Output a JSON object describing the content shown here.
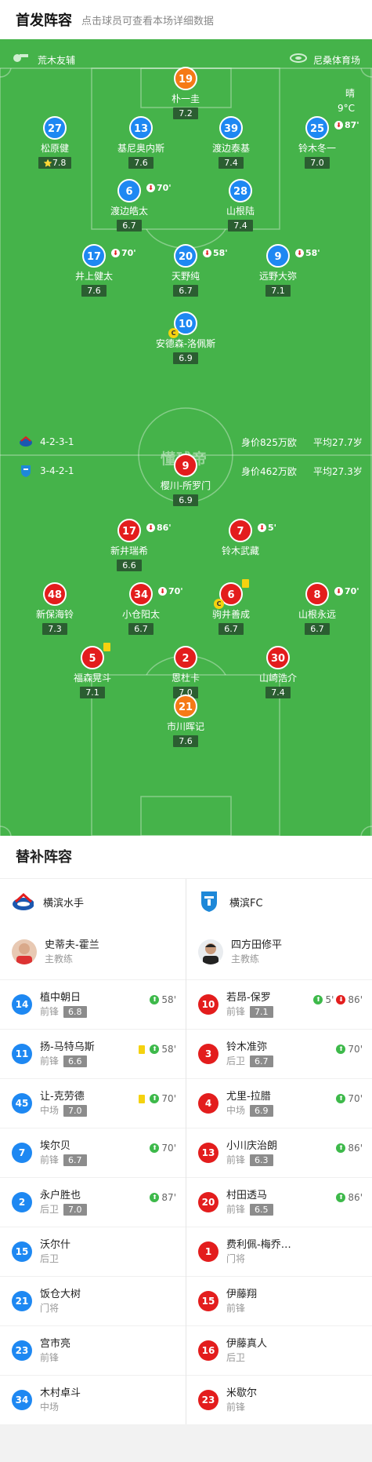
{
  "header": {
    "title": "首发阵容",
    "subtitle": "点击球员可查看本场详细数据"
  },
  "pitch": {
    "referee": "荒木友辅",
    "stadium": "尼桑体育场",
    "weather": "晴",
    "temperature": "9°C",
    "watermark": "懂球帝",
    "home": {
      "formation": "4-2-3-1",
      "value": "身价825万欧",
      "age": "平均27.7岁"
    },
    "away": {
      "formation": "3-4-2-1",
      "value": "身价462万欧",
      "age": "平均27.3岁"
    },
    "players": [
      {
        "num": "19",
        "name": "朴一圭",
        "rating": "7.2",
        "side": "gk"
      },
      {
        "num": "27",
        "name": "松原健",
        "rating": "7.8",
        "side": "h",
        "star": "⭐"
      },
      {
        "num": "13",
        "name": "基尼奥内斯",
        "rating": "7.6",
        "side": "h"
      },
      {
        "num": "39",
        "name": "渡边泰基",
        "rating": "7.4",
        "side": "h"
      },
      {
        "num": "25",
        "name": "铃木冬一",
        "rating": "7.0",
        "side": "h",
        "sub": "87'"
      },
      {
        "num": "6",
        "name": "渡边皓太",
        "rating": "6.7",
        "side": "h",
        "sub": "70'"
      },
      {
        "num": "28",
        "name": "山根陆",
        "rating": "7.4",
        "side": "h"
      },
      {
        "num": "17",
        "name": "井上健太",
        "rating": "7.6",
        "side": "h",
        "sub": "70'"
      },
      {
        "num": "20",
        "name": "天野纯",
        "rating": "6.7",
        "side": "h",
        "sub": "58'"
      },
      {
        "num": "9",
        "name": "远野大弥",
        "rating": "7.1",
        "side": "h",
        "sub": "58'"
      },
      {
        "num": "10",
        "name": "安德森-洛佩斯",
        "rating": "6.9",
        "side": "h",
        "captain": "C"
      },
      {
        "num": "9",
        "name": "樱川-所罗门",
        "rating": "6.9",
        "side": "a"
      },
      {
        "num": "17",
        "name": "新井瑞希",
        "rating": "6.6",
        "side": "a",
        "sub": "86'"
      },
      {
        "num": "7",
        "name": "铃木武藏",
        "rating": "",
        "side": "a",
        "sub": "5'"
      },
      {
        "num": "48",
        "name": "新保海铃",
        "rating": "7.3",
        "side": "a"
      },
      {
        "num": "34",
        "name": "小仓阳太",
        "rating": "6.7",
        "side": "a",
        "sub": "70'"
      },
      {
        "num": "6",
        "name": "驹井善成",
        "rating": "6.7",
        "side": "a",
        "captain": "C",
        "card": "yellow"
      },
      {
        "num": "8",
        "name": "山根永远",
        "rating": "6.7",
        "side": "a",
        "sub": "70'"
      },
      {
        "num": "5",
        "name": "福森晃斗",
        "rating": "7.1",
        "side": "a",
        "card": "yellow"
      },
      {
        "num": "2",
        "name": "恩杜卡",
        "rating": "7.0",
        "side": "a"
      },
      {
        "num": "30",
        "name": "山崎浩介",
        "rating": "7.4",
        "side": "a"
      },
      {
        "num": "21",
        "name": "市川晖记",
        "rating": "7.6",
        "side": "gk"
      }
    ]
  },
  "bench": {
    "title": "替补阵容",
    "home": {
      "team": "横滨水手",
      "coach": {
        "name": "史蒂夫-霍兰",
        "role": "主教练"
      },
      "subs": [
        {
          "num": "14",
          "name": "植中朝日",
          "pos": "前锋",
          "rating": "6.8",
          "in": "58'"
        },
        {
          "num": "11",
          "name": "扬-马特乌斯",
          "pos": "前锋",
          "rating": "6.6",
          "in": "58'",
          "card": "yellow"
        },
        {
          "num": "45",
          "name": "让-克劳德",
          "pos": "中场",
          "rating": "7.0",
          "in": "70'",
          "card": "yellow"
        },
        {
          "num": "7",
          "name": "埃尔贝",
          "pos": "前锋",
          "rating": "6.7",
          "in": "70'"
        },
        {
          "num": "2",
          "name": "永户胜也",
          "pos": "后卫",
          "rating": "7.0",
          "in": "87'"
        },
        {
          "num": "15",
          "name": "沃尔什",
          "pos": "后卫"
        },
        {
          "num": "21",
          "name": "饭仓大树",
          "pos": "门将"
        },
        {
          "num": "23",
          "name": "宫市亮",
          "pos": "前锋"
        },
        {
          "num": "34",
          "name": "木村卓斗",
          "pos": "中场"
        }
      ]
    },
    "away": {
      "team": "横滨FC",
      "coach": {
        "name": "四方田修平",
        "role": "主教练"
      },
      "subs": [
        {
          "num": "10",
          "name": "若昂-保罗",
          "pos": "前锋",
          "rating": "7.1",
          "in": "5'",
          "out": "86'"
        },
        {
          "num": "3",
          "name": "铃木准弥",
          "pos": "后卫",
          "rating": "6.7",
          "in": "70'"
        },
        {
          "num": "4",
          "name": "尤里-拉腊",
          "pos": "中场",
          "rating": "6.9",
          "in": "70'"
        },
        {
          "num": "13",
          "name": "小川庆治朗",
          "pos": "前锋",
          "rating": "6.3",
          "in": "86'"
        },
        {
          "num": "20",
          "name": "村田透马",
          "pos": "前锋",
          "rating": "6.5",
          "in": "86'"
        },
        {
          "num": "1",
          "name": "费利佩-梅乔…",
          "pos": "门将"
        },
        {
          "num": "15",
          "name": "伊藤翔",
          "pos": "前锋"
        },
        {
          "num": "16",
          "name": "伊藤真人",
          "pos": "后卫"
        },
        {
          "num": "23",
          "name": "米歇尔",
          "pos": "前锋"
        }
      ]
    }
  }
}
